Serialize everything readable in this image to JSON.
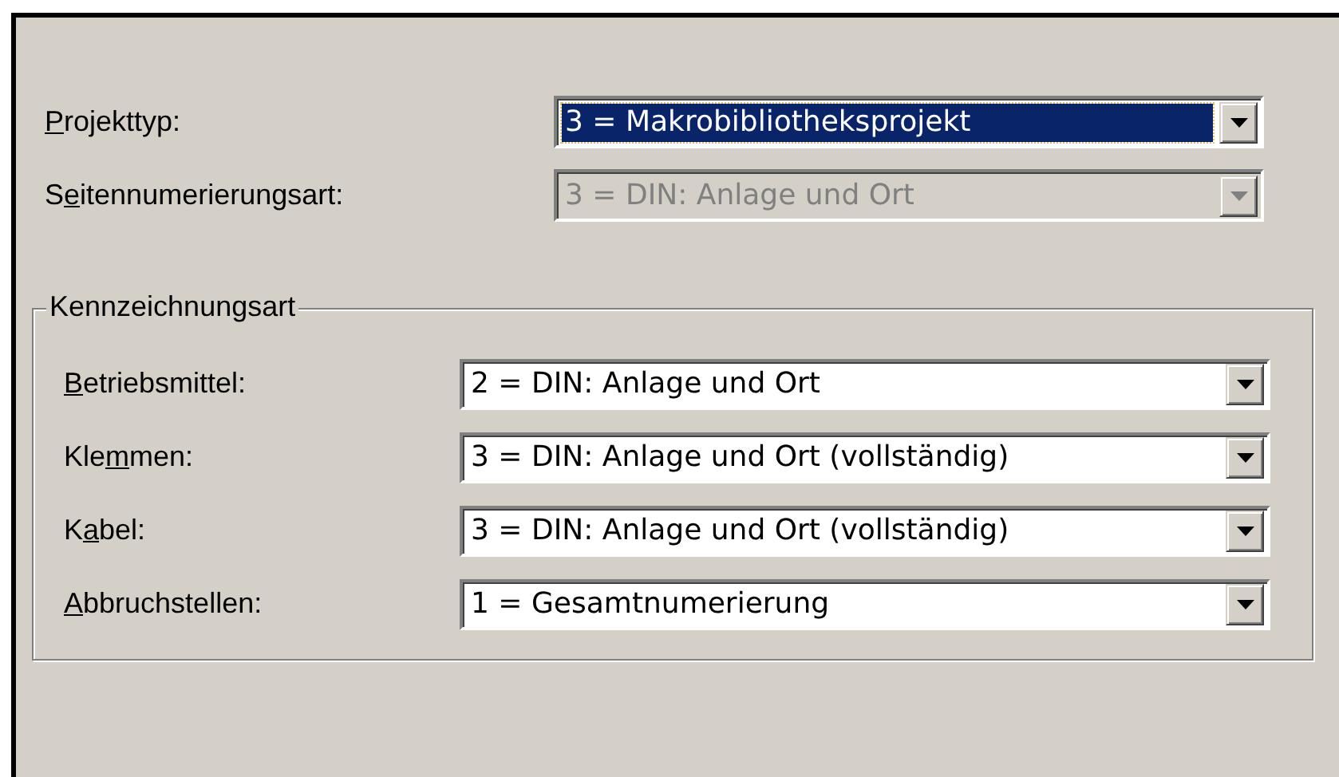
{
  "fields": [
    {
      "label": {
        "key": "P",
        "post": "rojekttyp:"
      },
      "value": "3 = Makrobibliotheksprojekt",
      "focused": true,
      "disabled": false
    },
    {
      "label": {
        "pre": "S",
        "key": "e",
        "post": "itennumerierungsart:"
      },
      "value": "3 = DIN: Anlage und Ort",
      "focused": false,
      "disabled": true
    }
  ],
  "group": {
    "title": "Kennzeichnungsart",
    "fields": [
      {
        "label": {
          "key": "B",
          "post": "etriebsmittel:"
        },
        "value": "2 = DIN: Anlage und Ort",
        "focused": false,
        "disabled": false
      },
      {
        "label": {
          "pre": "Kle",
          "key": "m",
          "post": "men:"
        },
        "value": "3 = DIN: Anlage und Ort (vollständig)",
        "focused": false,
        "disabled": false
      },
      {
        "label": {
          "pre": "K",
          "key": "a",
          "post": "bel:"
        },
        "value": "3 = DIN: Anlage und Ort (vollständig)",
        "focused": false,
        "disabled": false
      },
      {
        "label": {
          "key": "A",
          "post": "bbruchstellen:"
        },
        "value": "1 = Gesamtnumerierung",
        "focused": false,
        "disabled": false
      }
    ]
  }
}
